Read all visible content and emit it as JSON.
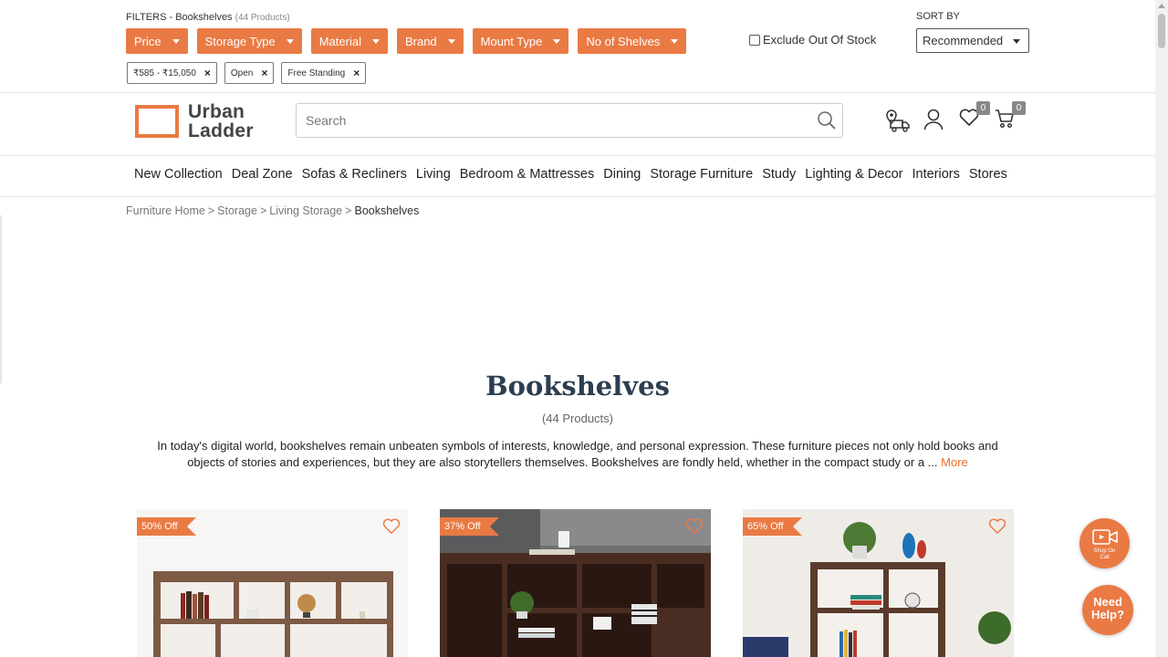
{
  "filters": {
    "title": "FILTERS - Bookshelves",
    "count": "(44 Products)",
    "buttons": [
      "Price",
      "Storage Type",
      "Material",
      "Brand",
      "Mount Type",
      "No of Shelves"
    ],
    "chips": [
      "₹585 - ₹15,050",
      "Open",
      "Free Standing"
    ],
    "exclude_label": "Exclude Out Of Stock",
    "sort_label": "SORT BY",
    "sort_value": "Recommended"
  },
  "header": {
    "logo_line1": "Urban",
    "logo_line2": "Ladder",
    "search_placeholder": "Search",
    "wishlist_count": "0",
    "cart_count": "0"
  },
  "nav": [
    "New Collection",
    "Deal Zone",
    "Sofas & Recliners",
    "Living",
    "Bedroom & Mattresses",
    "Dining",
    "Storage Furniture",
    "Study",
    "Lighting & Decor",
    "Interiors",
    "Stores"
  ],
  "breadcrumb": [
    "Furniture Home",
    "Storage",
    "Living Storage",
    "Bookshelves"
  ],
  "page": {
    "title": "Bookshelves",
    "count": "(44 Products)",
    "description": "In today's digital world, bookshelves remain unbeaten symbols of interests, knowledge, and personal expression. These furniture pieces not only hold books and objects of stories and experiences, but they are also storytellers themselves. Bookshelves are fondly held, whether in the compact study or a ...",
    "more": "More"
  },
  "products": [
    {
      "discount": "50% Off"
    },
    {
      "discount": "37% Off"
    },
    {
      "discount": "65% Off"
    }
  ],
  "floating": {
    "shop_label_1": "Shop On",
    "shop_label_2": "Call",
    "help_line1": "Need",
    "help_line2": "Help?"
  },
  "colors": {
    "accent": "#ea7a44",
    "title": "#2c3e50",
    "link": "#e8722c"
  }
}
